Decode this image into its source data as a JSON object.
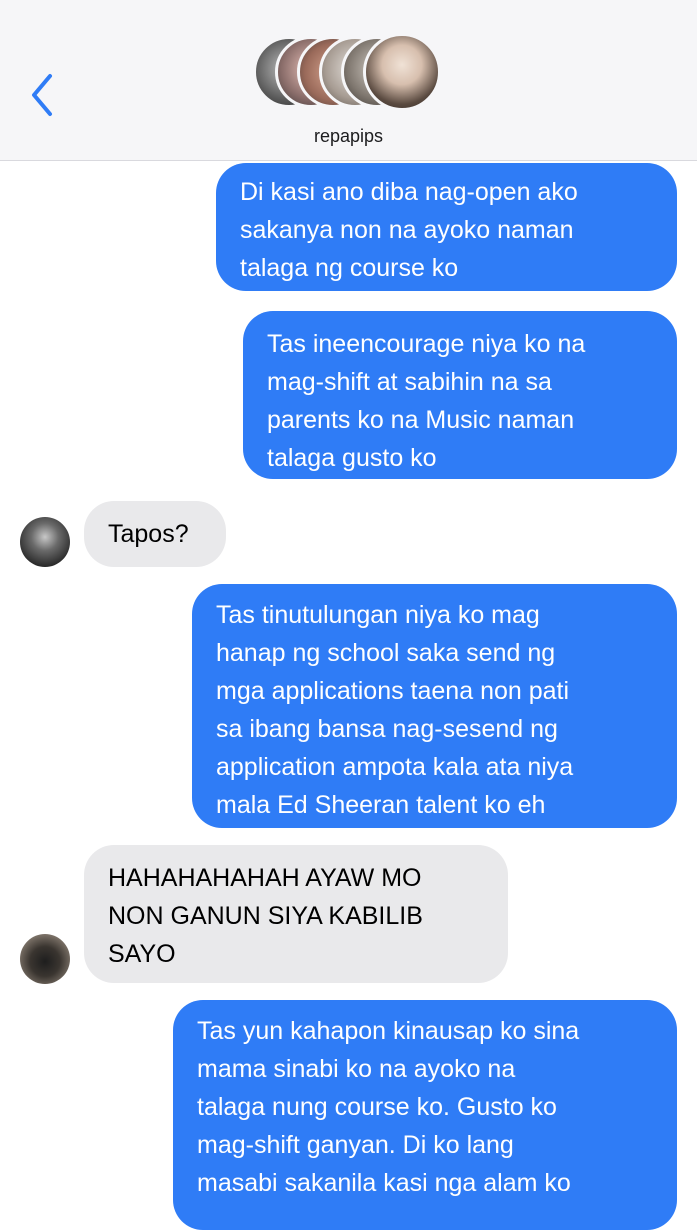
{
  "header": {
    "group_name": "repapips",
    "back_icon": "chevron-left-icon",
    "accent_color": "#2f7cf6"
  },
  "messages": [
    {
      "direction": "outgoing",
      "text": "Di kasi ano diba nag-open ako\nsakanya non na ayoko naman\ntalaga ng course ko"
    },
    {
      "direction": "outgoing",
      "text": "Tas ineencourage niya ko na\nmag-shift at sabihin na sa\nparents ko na Music naman\ntalaga gusto ko"
    },
    {
      "direction": "incoming",
      "text": "Tapos?"
    },
    {
      "direction": "outgoing",
      "text": "Tas tinutulungan niya ko mag\nhanap ng school saka send ng\nmga applications taena non pati\nsa ibang bansa nag-sesend ng\napplication ampota kala ata niya\nmala Ed Sheeran talent ko eh"
    },
    {
      "direction": "incoming",
      "text": "HAHAHAHAHAH AYAW MO\nNON GANUN SIYA KABILIB\nSAYO"
    },
    {
      "direction": "outgoing",
      "text": "Tas yun kahapon kinausap ko sina\nmama sinabi ko na ayoko na\ntalaga nung course ko. Gusto ko\nmag-shift ganyan. Di ko lang\nmasabi sakanila kasi nga alam ko"
    }
  ]
}
